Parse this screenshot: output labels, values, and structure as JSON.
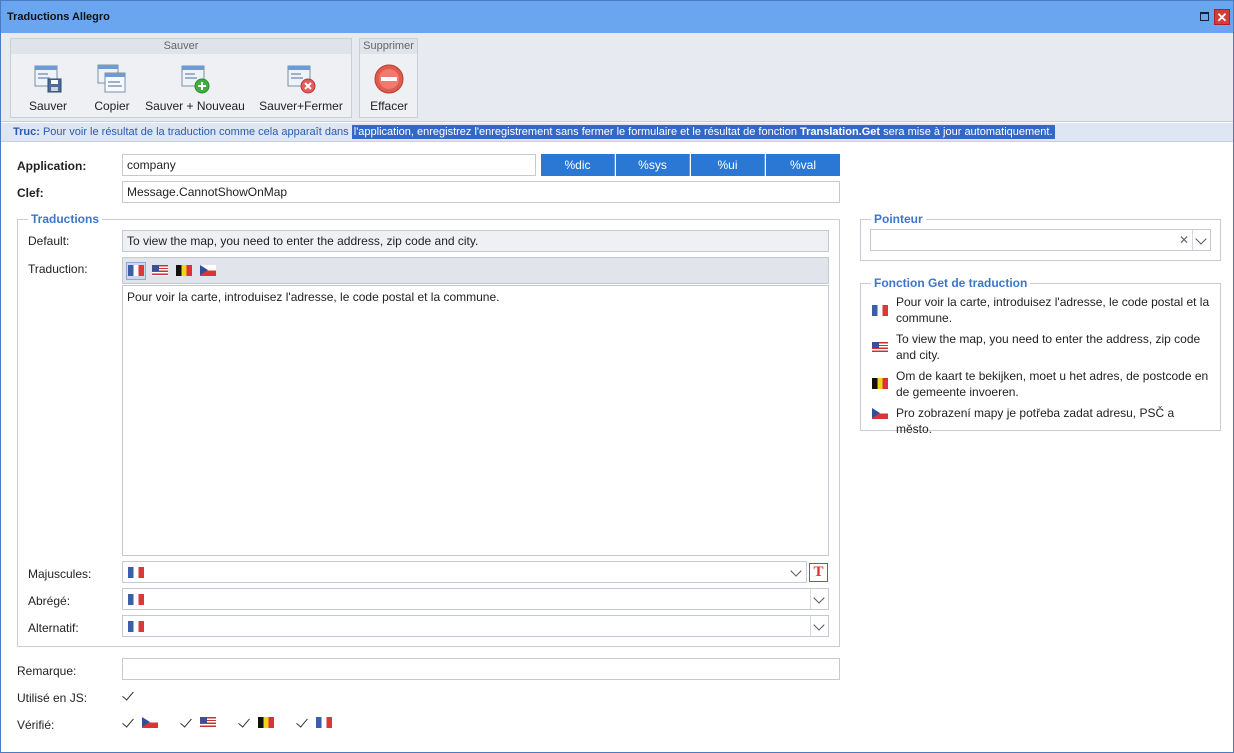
{
  "window": {
    "title": "Traductions Allegro",
    "close_glyph": "✕"
  },
  "ribbon": {
    "save_group": "Sauver",
    "delete_group": "Supprimer",
    "buttons": {
      "save": "Sauver",
      "copy": "Copier",
      "save_new": "Sauver + Nouveau",
      "save_close": "Sauver+Fermer",
      "delete": "Effacer"
    }
  },
  "tip": {
    "prefix": "Truc:",
    "text1": " Pour voir le résultat de la traduction comme cela apparaît dans ",
    "text2": "l'application, enregistrez l'enregistrement sans fermer le formulaire et le résultat de fonction ",
    "func": "Translation.Get",
    "text3": " sera mise à jour automatiquement."
  },
  "form": {
    "application_label": "Application:",
    "application_value": "company",
    "key_label": "Clef:",
    "key_value": "Message.CannotShowOnMap",
    "placeholders": [
      "%dic",
      "%sys",
      "%ui",
      "%val"
    ]
  },
  "translations": {
    "legend": "Traductions",
    "default_label": "Default:",
    "default_value": "To view the map, you need to enter the address, zip code and city.",
    "translation_label": "Traduction:",
    "flags": [
      "fr",
      "us",
      "be",
      "cz"
    ],
    "translation_value": "Pour voir la carte, introduisez l'adresse, le code postal et la commune.",
    "uppercase_label": "Majuscules:",
    "short_label": "Abrégé:",
    "alternative_label": "Alternatif:",
    "uppercase_button": "T"
  },
  "remark_label": "Remarque:",
  "used_js_label": "Utilisé en JS:",
  "verified_label": "Vérifié:",
  "verified_flags": [
    "cz",
    "us",
    "be",
    "fr"
  ],
  "pointer": {
    "legend": "Pointeur",
    "clear_glyph": "✕"
  },
  "get_function": {
    "legend": "Fonction Get de traduction",
    "entries": [
      {
        "flag": "fr",
        "text": "Pour voir la carte, introduisez l'adresse, le code postal et la commune."
      },
      {
        "flag": "us",
        "text": "To view the map, you need to enter the address, zip code and city."
      },
      {
        "flag": "be",
        "text": "Om de kaart te bekijken, moet u het adres, de postcode en de gemeente invoeren."
      },
      {
        "flag": "cz",
        "text": "Pro zobrazení mapy je potřeba zadat adresu, PSČ a město."
      }
    ]
  },
  "colors": {
    "titlebar": "#6aa6ef",
    "accent": "#2a78d4",
    "legend": "#3b76c9",
    "close": "#d33c3c"
  }
}
